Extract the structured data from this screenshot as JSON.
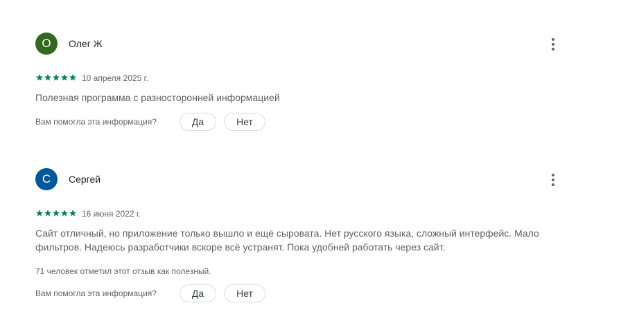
{
  "reviews": [
    {
      "avatar_letter": "О",
      "avatar_color": "#33691e",
      "author": "Олег Ж",
      "rating": 5,
      "date": "10 апреля 2025 г.",
      "text": "Полезная программа с разносторонней информацией",
      "helpful_count_text": "",
      "helpful_question": "Вам помогла эта информация?",
      "yes_label": "Да",
      "no_label": "Нет"
    },
    {
      "avatar_letter": "С",
      "avatar_color": "#01579b",
      "author": "Сергей",
      "rating": 5,
      "date": "16 июня 2022 г.",
      "text": "Сайт отличный, но приложение только вышло и ещё сыровата. Нет русского языка, сложный интерфейс. Мало фильтров. Надеюсь разработчики вскоре всё устранят. Пока удобней работать через сайт.",
      "helpful_count_text": "71 человек отметил этот отзыв как полезный.",
      "helpful_question": "Вам помогла эта информация?",
      "yes_label": "Да",
      "no_label": "Нет"
    }
  ],
  "icons": {
    "star": "star-icon",
    "more": "more-vert-icon"
  },
  "colors": {
    "star": "#01875f"
  }
}
